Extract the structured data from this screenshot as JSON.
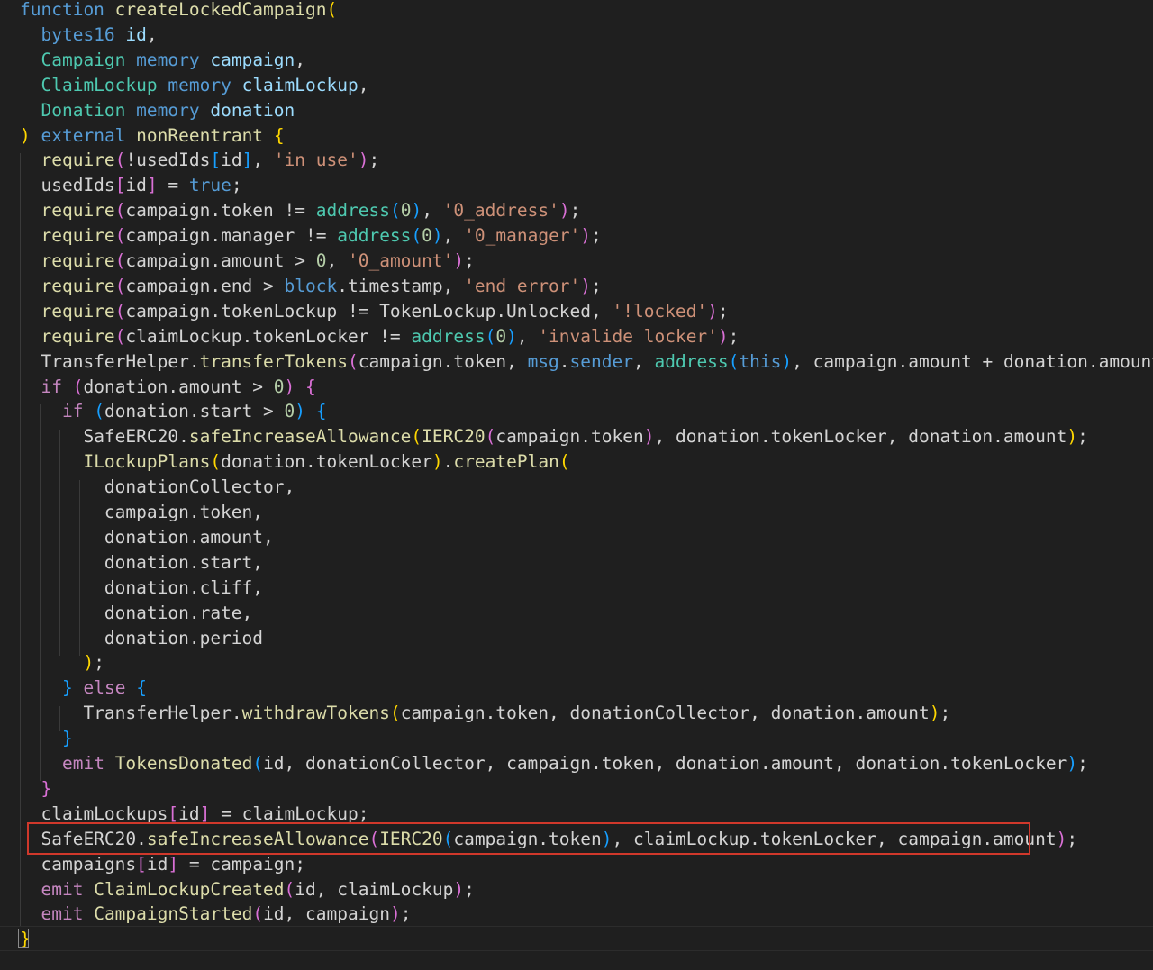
{
  "editor": {
    "lines": [
      [
        [
          "function",
          "kw"
        ],
        [
          " ",
          "pl"
        ],
        [
          "createLockedCampaign",
          "fn"
        ],
        [
          "(",
          "b1"
        ]
      ],
      [
        [
          "  ",
          "pl"
        ],
        [
          "bytes16",
          "kw"
        ],
        [
          " ",
          "pl"
        ],
        [
          "id",
          "var"
        ],
        [
          ",",
          "pl"
        ]
      ],
      [
        [
          "  ",
          "pl"
        ],
        [
          "Campaign",
          "ty"
        ],
        [
          " ",
          "pl"
        ],
        [
          "memory",
          "kw"
        ],
        [
          " ",
          "pl"
        ],
        [
          "campaign",
          "var"
        ],
        [
          ",",
          "pl"
        ]
      ],
      [
        [
          "  ",
          "pl"
        ],
        [
          "ClaimLockup",
          "ty"
        ],
        [
          " ",
          "pl"
        ],
        [
          "memory",
          "kw"
        ],
        [
          " ",
          "pl"
        ],
        [
          "claimLockup",
          "var"
        ],
        [
          ",",
          "pl"
        ]
      ],
      [
        [
          "  ",
          "pl"
        ],
        [
          "Donation",
          "ty"
        ],
        [
          " ",
          "pl"
        ],
        [
          "memory",
          "kw"
        ],
        [
          " ",
          "pl"
        ],
        [
          "donation",
          "var"
        ]
      ],
      [
        [
          ")",
          "b1"
        ],
        [
          " ",
          "pl"
        ],
        [
          "external",
          "kw"
        ],
        [
          " ",
          "pl"
        ],
        [
          "nonReentrant",
          "fn"
        ],
        [
          " ",
          "pl"
        ],
        [
          "{",
          "b1"
        ]
      ],
      [
        [
          "  ",
          "pl"
        ],
        [
          "require",
          "fn"
        ],
        [
          "(",
          "b2"
        ],
        [
          "!usedIds",
          "pl"
        ],
        [
          "[",
          "b3"
        ],
        [
          "id",
          "pl"
        ],
        [
          "]",
          "b3"
        ],
        [
          ", ",
          "pl"
        ],
        [
          "'in use'",
          "str"
        ],
        [
          ")",
          "b2"
        ],
        [
          ";",
          "pl"
        ]
      ],
      [
        [
          "  ",
          "pl"
        ],
        [
          "usedIds",
          "pl"
        ],
        [
          "[",
          "b2"
        ],
        [
          "id",
          "pl"
        ],
        [
          "]",
          "b2"
        ],
        [
          " = ",
          "pl"
        ],
        [
          "true",
          "kw"
        ],
        [
          ";",
          "pl"
        ]
      ],
      [
        [
          "  ",
          "pl"
        ],
        [
          "require",
          "fn"
        ],
        [
          "(",
          "b2"
        ],
        [
          "campaign.token != ",
          "pl"
        ],
        [
          "address",
          "ty"
        ],
        [
          "(",
          "b3"
        ],
        [
          "0",
          "num"
        ],
        [
          ")",
          "b3"
        ],
        [
          ", ",
          "pl"
        ],
        [
          "'0_address'",
          "str"
        ],
        [
          ")",
          "b2"
        ],
        [
          ";",
          "pl"
        ]
      ],
      [
        [
          "  ",
          "pl"
        ],
        [
          "require",
          "fn"
        ],
        [
          "(",
          "b2"
        ],
        [
          "campaign.manager != ",
          "pl"
        ],
        [
          "address",
          "ty"
        ],
        [
          "(",
          "b3"
        ],
        [
          "0",
          "num"
        ],
        [
          ")",
          "b3"
        ],
        [
          ", ",
          "pl"
        ],
        [
          "'0_manager'",
          "str"
        ],
        [
          ")",
          "b2"
        ],
        [
          ";",
          "pl"
        ]
      ],
      [
        [
          "  ",
          "pl"
        ],
        [
          "require",
          "fn"
        ],
        [
          "(",
          "b2"
        ],
        [
          "campaign.amount > ",
          "pl"
        ],
        [
          "0",
          "num"
        ],
        [
          ", ",
          "pl"
        ],
        [
          "'0_amount'",
          "str"
        ],
        [
          ")",
          "b2"
        ],
        [
          ";",
          "pl"
        ]
      ],
      [
        [
          "  ",
          "pl"
        ],
        [
          "require",
          "fn"
        ],
        [
          "(",
          "b2"
        ],
        [
          "campaign.end > ",
          "pl"
        ],
        [
          "block",
          "kw"
        ],
        [
          ".timestamp, ",
          "pl"
        ],
        [
          "'end error'",
          "str"
        ],
        [
          ")",
          "b2"
        ],
        [
          ";",
          "pl"
        ]
      ],
      [
        [
          "  ",
          "pl"
        ],
        [
          "require",
          "fn"
        ],
        [
          "(",
          "b2"
        ],
        [
          "campaign.tokenLockup != TokenLockup.Unlocked, ",
          "pl"
        ],
        [
          "'!locked'",
          "str"
        ],
        [
          ")",
          "b2"
        ],
        [
          ";",
          "pl"
        ]
      ],
      [
        [
          "  ",
          "pl"
        ],
        [
          "require",
          "fn"
        ],
        [
          "(",
          "b2"
        ],
        [
          "claimLockup.tokenLocker != ",
          "pl"
        ],
        [
          "address",
          "ty"
        ],
        [
          "(",
          "b3"
        ],
        [
          "0",
          "num"
        ],
        [
          ")",
          "b3"
        ],
        [
          ", ",
          "pl"
        ],
        [
          "'invalide locker'",
          "str"
        ],
        [
          ")",
          "b2"
        ],
        [
          ";",
          "pl"
        ]
      ],
      [
        [
          "  ",
          "pl"
        ],
        [
          "TransferHelper.",
          "pl"
        ],
        [
          "transferTokens",
          "fn"
        ],
        [
          "(",
          "b2"
        ],
        [
          "campaign.token, ",
          "pl"
        ],
        [
          "msg",
          "kw"
        ],
        [
          ".",
          "pl"
        ],
        [
          "sender",
          "kw"
        ],
        [
          ", ",
          "pl"
        ],
        [
          "address",
          "ty"
        ],
        [
          "(",
          "b3"
        ],
        [
          "this",
          "kw"
        ],
        [
          ")",
          "b3"
        ],
        [
          ", campaign.amount + donation.amount",
          "pl"
        ],
        [
          ")",
          "b2"
        ],
        [
          ";",
          "pl"
        ]
      ],
      [
        [
          "  ",
          "pl"
        ],
        [
          "if",
          "ctl"
        ],
        [
          " ",
          "pl"
        ],
        [
          "(",
          "b2"
        ],
        [
          "donation.amount > ",
          "pl"
        ],
        [
          "0",
          "num"
        ],
        [
          ")",
          "b2"
        ],
        [
          " ",
          "pl"
        ],
        [
          "{",
          "b2"
        ]
      ],
      [
        [
          "    ",
          "pl"
        ],
        [
          "if",
          "ctl"
        ],
        [
          " ",
          "pl"
        ],
        [
          "(",
          "b3"
        ],
        [
          "donation.start > ",
          "pl"
        ],
        [
          "0",
          "num"
        ],
        [
          ")",
          "b3"
        ],
        [
          " ",
          "pl"
        ],
        [
          "{",
          "b3"
        ]
      ],
      [
        [
          "      ",
          "pl"
        ],
        [
          "SafeERC20.",
          "pl"
        ],
        [
          "safeIncreaseAllowance",
          "fn"
        ],
        [
          "(",
          "b1"
        ],
        [
          "IERC20",
          "fn"
        ],
        [
          "(",
          "b2"
        ],
        [
          "campaign.token",
          "pl"
        ],
        [
          ")",
          "b2"
        ],
        [
          ", donation.tokenLocker, donation.amount",
          "pl"
        ],
        [
          ")",
          "b1"
        ],
        [
          ";",
          "pl"
        ]
      ],
      [
        [
          "      ",
          "pl"
        ],
        [
          "ILockupPlans",
          "fn"
        ],
        [
          "(",
          "b1"
        ],
        [
          "donation.tokenLocker",
          "pl"
        ],
        [
          ")",
          "b1"
        ],
        [
          ".",
          "pl"
        ],
        [
          "createPlan",
          "fn"
        ],
        [
          "(",
          "b1"
        ]
      ],
      [
        [
          "        ",
          "pl"
        ],
        [
          "donationCollector,",
          "pl"
        ]
      ],
      [
        [
          "        ",
          "pl"
        ],
        [
          "campaign.token,",
          "pl"
        ]
      ],
      [
        [
          "        ",
          "pl"
        ],
        [
          "donation.amount,",
          "pl"
        ]
      ],
      [
        [
          "        ",
          "pl"
        ],
        [
          "donation.start,",
          "pl"
        ]
      ],
      [
        [
          "        ",
          "pl"
        ],
        [
          "donation.cliff,",
          "pl"
        ]
      ],
      [
        [
          "        ",
          "pl"
        ],
        [
          "donation.rate,",
          "pl"
        ]
      ],
      [
        [
          "        ",
          "pl"
        ],
        [
          "donation.period",
          "pl"
        ]
      ],
      [
        [
          "      ",
          "pl"
        ],
        [
          ")",
          "b1"
        ],
        [
          ";",
          "pl"
        ]
      ],
      [
        [
          "    ",
          "pl"
        ],
        [
          "}",
          "b3"
        ],
        [
          " ",
          "pl"
        ],
        [
          "else",
          "ctl"
        ],
        [
          " ",
          "pl"
        ],
        [
          "{",
          "b3"
        ]
      ],
      [
        [
          "      ",
          "pl"
        ],
        [
          "TransferHelper.",
          "pl"
        ],
        [
          "withdrawTokens",
          "fn"
        ],
        [
          "(",
          "b1"
        ],
        [
          "campaign.token, donationCollector, donation.amount",
          "pl"
        ],
        [
          ")",
          "b1"
        ],
        [
          ";",
          "pl"
        ]
      ],
      [
        [
          "    ",
          "pl"
        ],
        [
          "}",
          "b3"
        ]
      ],
      [
        [
          "    ",
          "pl"
        ],
        [
          "emit",
          "ctl"
        ],
        [
          " ",
          "pl"
        ],
        [
          "TokensDonated",
          "fn"
        ],
        [
          "(",
          "b3"
        ],
        [
          "id, donationCollector, campaign.token, donation.amount, donation.tokenLocker",
          "pl"
        ],
        [
          ")",
          "b3"
        ],
        [
          ";",
          "pl"
        ]
      ],
      [
        [
          "  ",
          "pl"
        ],
        [
          "}",
          "b2"
        ]
      ],
      [
        [
          "  ",
          "pl"
        ],
        [
          "claimLockups",
          "pl"
        ],
        [
          "[",
          "b2"
        ],
        [
          "id",
          "pl"
        ],
        [
          "]",
          "b2"
        ],
        [
          " = claimLockup;",
          "pl"
        ]
      ],
      [
        [
          "  ",
          "pl"
        ],
        [
          "SafeERC20.",
          "pl"
        ],
        [
          "safeIncreaseAllowance",
          "fn"
        ],
        [
          "(",
          "b2"
        ],
        [
          "IERC20",
          "fn"
        ],
        [
          "(",
          "b3"
        ],
        [
          "campaign.token",
          "pl"
        ],
        [
          ")",
          "b3"
        ],
        [
          ", claimLockup.tokenLocker, campaign.amount",
          "pl"
        ],
        [
          ")",
          "b2"
        ],
        [
          ";",
          "pl"
        ]
      ],
      [
        [
          "  ",
          "pl"
        ],
        [
          "campaigns",
          "pl"
        ],
        [
          "[",
          "b2"
        ],
        [
          "id",
          "pl"
        ],
        [
          "]",
          "b2"
        ],
        [
          " = campaign;",
          "pl"
        ]
      ],
      [
        [
          "  ",
          "pl"
        ],
        [
          "emit",
          "ctl"
        ],
        [
          " ",
          "pl"
        ],
        [
          "ClaimLockupCreated",
          "fn"
        ],
        [
          "(",
          "b2"
        ],
        [
          "id, claimLockup",
          "pl"
        ],
        [
          ")",
          "b2"
        ],
        [
          ";",
          "pl"
        ]
      ],
      [
        [
          "  ",
          "pl"
        ],
        [
          "emit",
          "ctl"
        ],
        [
          " ",
          "pl"
        ],
        [
          "CampaignStarted",
          "fn"
        ],
        [
          "(",
          "b2"
        ],
        [
          "id, campaign",
          "pl"
        ],
        [
          ")",
          "b2"
        ],
        [
          ";",
          "pl"
        ]
      ],
      [
        [
          "}",
          "b1"
        ]
      ]
    ]
  }
}
